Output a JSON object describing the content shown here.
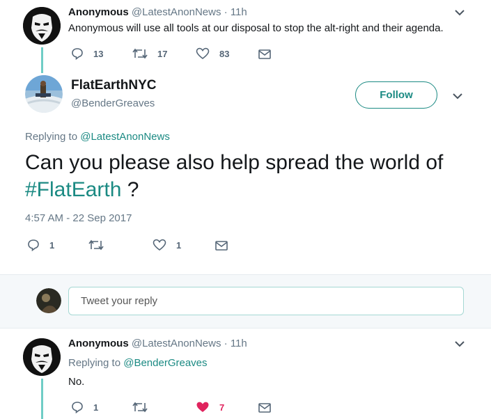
{
  "tweet1": {
    "name": "Anonymous",
    "handle": "@LatestAnonNews",
    "time": "· 11h",
    "text": "Anonymous will use all tools at our disposal to stop the alt-right and their agenda.",
    "replies": "13",
    "retweets": "17",
    "likes": "83"
  },
  "main": {
    "name": "FlatEarthNYC",
    "handle": "@BenderGreaves",
    "follow_label": "Follow",
    "replying_prefix": "Replying to",
    "replying_handle": "@LatestAnonNews",
    "text_prefix": "Can you please also help spread the world of",
    "hashtag": "#FlatEarth",
    "text_suffix": " ?",
    "timestamp": "4:57 AM - 22 Sep 2017",
    "replies": "1",
    "retweets": "",
    "likes": "1"
  },
  "reply_box": {
    "placeholder": "Tweet your reply"
  },
  "tweet3": {
    "name": "Anonymous",
    "handle": "@LatestAnonNews",
    "time": "· 11h",
    "replying_prefix": "Replying to",
    "replying_handle": "@BenderGreaves",
    "text": "No.",
    "replies": "1",
    "retweets": "",
    "likes": "7"
  },
  "colors": {
    "accent": "#1b8a83",
    "thread_line": "#6fcdc6",
    "liked": "#e0245e"
  }
}
